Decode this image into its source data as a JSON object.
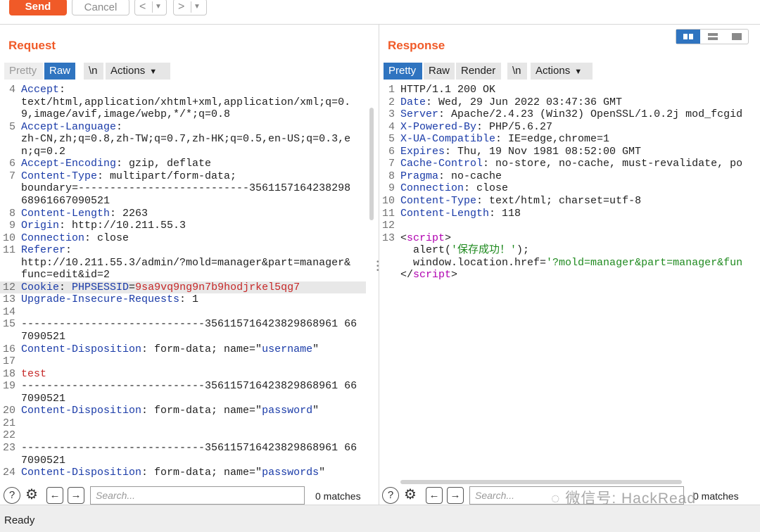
{
  "toolbar": {
    "send_label": "Send",
    "cancel_label": "Cancel",
    "back_label": "<",
    "forward_label": ">",
    "dropdown_glyph": "▼"
  },
  "request": {
    "title": "Request",
    "tabs": [
      "Pretty",
      "Raw",
      "\\n",
      "Actions"
    ],
    "active_tab": "Raw",
    "lines": [
      {
        "n": "4",
        "segments": [
          {
            "t": "Accept",
            "c": "key"
          },
          {
            "t": ":",
            "c": ""
          }
        ]
      },
      {
        "n": "",
        "segments": [
          {
            "t": "text/html,application/xhtml+xml,application/xml;q=0.",
            "c": ""
          }
        ]
      },
      {
        "n": "",
        "segments": [
          {
            "t": "9,image/avif,image/webp,*/*;q=0.8",
            "c": ""
          }
        ]
      },
      {
        "n": "5",
        "segments": [
          {
            "t": "Accept-Language",
            "c": "key"
          },
          {
            "t": ":",
            "c": ""
          }
        ]
      },
      {
        "n": "",
        "segments": [
          {
            "t": "zh-CN,zh;q=0.8,zh-TW;q=0.7,zh-HK;q=0.5,en-US;q=0.3,e",
            "c": ""
          }
        ]
      },
      {
        "n": "",
        "segments": [
          {
            "t": "n;q=0.2",
            "c": ""
          }
        ]
      },
      {
        "n": "6",
        "segments": [
          {
            "t": "Accept-Encoding",
            "c": "key"
          },
          {
            "t": ": gzip, deflate",
            "c": ""
          }
        ]
      },
      {
        "n": "7",
        "segments": [
          {
            "t": "Content-Type",
            "c": "key"
          },
          {
            "t": ": multipart/form-data;",
            "c": ""
          }
        ]
      },
      {
        "n": "",
        "segments": [
          {
            "t": "boundary=---------------------------3561157164238298",
            "c": ""
          }
        ]
      },
      {
        "n": "",
        "segments": [
          {
            "t": "68961667090521",
            "c": ""
          }
        ]
      },
      {
        "n": "8",
        "segments": [
          {
            "t": "Content-Length",
            "c": "key"
          },
          {
            "t": ": 2263",
            "c": ""
          }
        ]
      },
      {
        "n": "9",
        "segments": [
          {
            "t": "Origin",
            "c": "key"
          },
          {
            "t": ": http://10.211.55.3",
            "c": ""
          }
        ]
      },
      {
        "n": "10",
        "segments": [
          {
            "t": "Connection",
            "c": "key"
          },
          {
            "t": ": close",
            "c": ""
          }
        ]
      },
      {
        "n": "11",
        "segments": [
          {
            "t": "Referer",
            "c": "key"
          },
          {
            "t": ":",
            "c": ""
          }
        ]
      },
      {
        "n": "",
        "segments": [
          {
            "t": "http://10.211.55.3/admin/?mold=manager&part=manager&",
            "c": ""
          }
        ]
      },
      {
        "n": "",
        "segments": [
          {
            "t": "func=edit&id=2",
            "c": ""
          }
        ]
      },
      {
        "n": "12",
        "hl": true,
        "segments": [
          {
            "t": "Cookie",
            "c": "key"
          },
          {
            "t": ": ",
            "c": ""
          },
          {
            "t": "PHPSESSID",
            "c": "key"
          },
          {
            "t": "=",
            "c": ""
          },
          {
            "t": "9sa9vq9ng9n7b9hodjrkel5qg7",
            "c": "red"
          }
        ]
      },
      {
        "n": "13",
        "segments": [
          {
            "t": "Upgrade-Insecure-Requests",
            "c": "key"
          },
          {
            "t": ": 1",
            "c": ""
          }
        ]
      },
      {
        "n": "14",
        "segments": []
      },
      {
        "n": "15",
        "segments": [
          {
            "t": "-----------------------------356115716423829868961 66",
            "c": ""
          }
        ]
      },
      {
        "n": "",
        "segments": [
          {
            "t": "7090521",
            "c": ""
          }
        ]
      },
      {
        "n": "16",
        "segments": [
          {
            "t": "Content-Disposition",
            "c": "key"
          },
          {
            "t": ": form-data; name=\"",
            "c": ""
          },
          {
            "t": "username",
            "c": "str"
          },
          {
            "t": "\"",
            "c": ""
          }
        ]
      },
      {
        "n": "17",
        "segments": []
      },
      {
        "n": "18",
        "segments": [
          {
            "t": "test",
            "c": "red"
          }
        ]
      },
      {
        "n": "19",
        "segments": [
          {
            "t": "-----------------------------356115716423829868961 66",
            "c": ""
          }
        ]
      },
      {
        "n": "",
        "segments": [
          {
            "t": "7090521",
            "c": ""
          }
        ]
      },
      {
        "n": "20",
        "segments": [
          {
            "t": "Content-Disposition",
            "c": "key"
          },
          {
            "t": ": form-data; name=\"",
            "c": ""
          },
          {
            "t": "password",
            "c": "str"
          },
          {
            "t": "\"",
            "c": ""
          }
        ]
      },
      {
        "n": "21",
        "segments": []
      },
      {
        "n": "22",
        "segments": []
      },
      {
        "n": "23",
        "segments": [
          {
            "t": "-----------------------------356115716423829868961 66",
            "c": ""
          }
        ]
      },
      {
        "n": "",
        "segments": [
          {
            "t": "7090521",
            "c": ""
          }
        ]
      },
      {
        "n": "24",
        "segments": [
          {
            "t": "Content-Disposition",
            "c": "key"
          },
          {
            "t": ": form-data; name=\"",
            "c": ""
          },
          {
            "t": "passwords",
            "c": "str"
          },
          {
            "t": "\"",
            "c": ""
          }
        ]
      }
    ],
    "search_placeholder": "Search...",
    "matches": "0 matches"
  },
  "response": {
    "title": "Response",
    "tabs": [
      "Pretty",
      "Raw",
      "Render",
      "\\n",
      "Actions"
    ],
    "active_tab": "Pretty",
    "lines": [
      {
        "n": "1",
        "segments": [
          {
            "t": "HTTP/1.1 200 OK",
            "c": ""
          }
        ]
      },
      {
        "n": "2",
        "segments": [
          {
            "t": "Date",
            "c": "key"
          },
          {
            "t": ": Wed, 29 Jun 2022 03:47:36 GMT",
            "c": ""
          }
        ]
      },
      {
        "n": "3",
        "segments": [
          {
            "t": "Server",
            "c": "key"
          },
          {
            "t": ": Apache/2.4.23 (Win32) OpenSSL/1.0.2j mod_fcgid",
            "c": ""
          }
        ]
      },
      {
        "n": "4",
        "segments": [
          {
            "t": "X-Powered-By",
            "c": "key"
          },
          {
            "t": ": PHP/5.6.27",
            "c": ""
          }
        ]
      },
      {
        "n": "5",
        "segments": [
          {
            "t": "X-UA-Compatible",
            "c": "key"
          },
          {
            "t": ": IE=edge,chrome=1",
            "c": ""
          }
        ]
      },
      {
        "n": "6",
        "segments": [
          {
            "t": "Expires",
            "c": "key"
          },
          {
            "t": ": Thu, 19 Nov 1981 08:52:00 GMT",
            "c": ""
          }
        ]
      },
      {
        "n": "7",
        "segments": [
          {
            "t": "Cache-Control",
            "c": "key"
          },
          {
            "t": ": no-store, no-cache, must-revalidate, po",
            "c": ""
          }
        ]
      },
      {
        "n": "8",
        "segments": [
          {
            "t": "Pragma",
            "c": "key"
          },
          {
            "t": ": no-cache",
            "c": ""
          }
        ]
      },
      {
        "n": "9",
        "segments": [
          {
            "t": "Connection",
            "c": "key"
          },
          {
            "t": ": close",
            "c": ""
          }
        ]
      },
      {
        "n": "10",
        "segments": [
          {
            "t": "Content-Type",
            "c": "key"
          },
          {
            "t": ": text/html; charset=utf-8",
            "c": ""
          }
        ]
      },
      {
        "n": "11",
        "segments": [
          {
            "t": "Content-Length",
            "c": "key"
          },
          {
            "t": ": 118",
            "c": ""
          }
        ]
      },
      {
        "n": "12",
        "segments": []
      },
      {
        "n": "13",
        "segments": [
          {
            "t": "<",
            "c": ""
          },
          {
            "t": "script",
            "c": "tag"
          },
          {
            "t": ">",
            "c": ""
          }
        ]
      },
      {
        "n": "",
        "segments": [
          {
            "t": "  alert(",
            "c": ""
          },
          {
            "t": "'保存成功！'",
            "c": "grn"
          },
          {
            "t": ");",
            "c": ""
          }
        ]
      },
      {
        "n": "",
        "segments": [
          {
            "t": "  window.location.href=",
            "c": ""
          },
          {
            "t": "'?mold=manager&part=manager&fun",
            "c": "grn"
          }
        ]
      },
      {
        "n": "",
        "segments": [
          {
            "t": "</",
            "c": ""
          },
          {
            "t": "script",
            "c": "tag"
          },
          {
            "t": ">",
            "c": ""
          }
        ]
      }
    ],
    "search_placeholder": "Search...",
    "matches": "0 matches"
  },
  "status_text": "Ready",
  "watermark_text": "微信号: HackRead",
  "colors": {
    "accent": "#f05a28",
    "tab_active": "#2f74c0",
    "key": "#1a3ba8",
    "value_red": "#c62828",
    "value_green": "#1f8a1f",
    "tag": "#b000b0"
  }
}
